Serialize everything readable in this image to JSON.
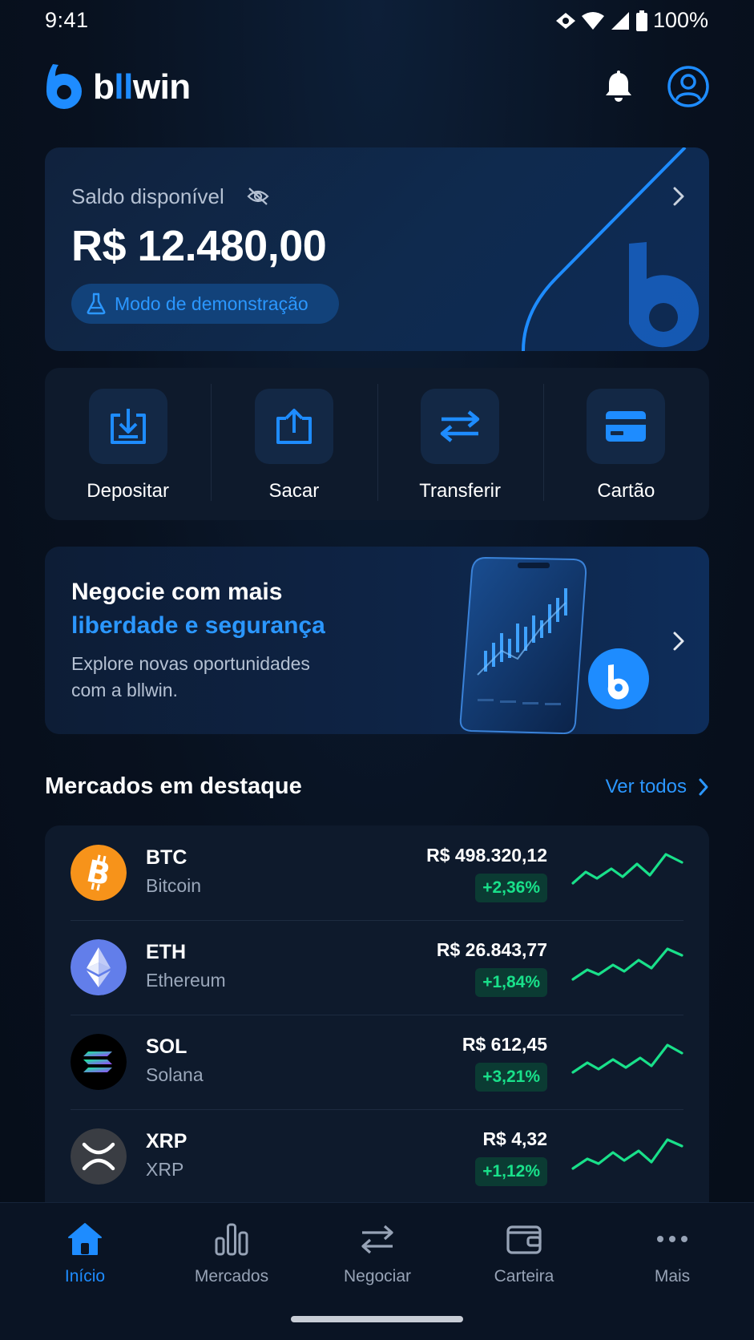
{
  "status_bar": {
    "time": "9:41",
    "battery": "100%"
  },
  "header": {
    "brand_prefix": "b",
    "brand_highlight": "ll",
    "brand_suffix": "win"
  },
  "balance": {
    "label": "Saldo disponível",
    "value": "R$ 12.480,00",
    "demo_label": "Modo de demonstração"
  },
  "actions": [
    {
      "label": "Depositar",
      "icon": "download-tray-icon"
    },
    {
      "label": "Sacar",
      "icon": "upload-tray-icon"
    },
    {
      "label": "Transferir",
      "icon": "transfer-arrows-icon"
    },
    {
      "label": "Cartão",
      "icon": "credit-card-icon"
    }
  ],
  "promo": {
    "title": "Negocie com mais",
    "highlight": "liberdade e segurança",
    "desc_line1": "Explore novas oportunidades",
    "desc_line2": "com a bllwin."
  },
  "markets": {
    "title": "Mercados em destaque",
    "see_all": "Ver todos",
    "items": [
      {
        "symbol": "BTC",
        "name": "Bitcoin",
        "price": "R$ 498.320,12",
        "change": "+2,36%",
        "logo_color": "#f7931a"
      },
      {
        "symbol": "ETH",
        "name": "Ethereum",
        "price": "R$ 26.843,77",
        "change": "+1,84%",
        "logo_color": "#627eea"
      },
      {
        "symbol": "SOL",
        "name": "Solana",
        "price": "R$ 612,45",
        "change": "+3,21%",
        "logo_color": "#000000"
      },
      {
        "symbol": "XRP",
        "name": "XRP",
        "price": "R$ 4,32",
        "change": "+1,12%",
        "logo_color": "#3a3d43"
      }
    ]
  },
  "nav": {
    "items": [
      {
        "label": "Início",
        "icon": "home-icon",
        "active": true
      },
      {
        "label": "Mercados",
        "icon": "bar-chart-icon",
        "active": false
      },
      {
        "label": "Negociar",
        "icon": "swap-arrows-icon",
        "active": false
      },
      {
        "label": "Carteira",
        "icon": "wallet-icon",
        "active": false
      },
      {
        "label": "Mais",
        "icon": "more-dots-icon",
        "active": false
      }
    ]
  },
  "colors": {
    "accent": "#1e8cff",
    "positive": "#19e08a",
    "background": "#08111f",
    "card": "#0e1a2c"
  }
}
